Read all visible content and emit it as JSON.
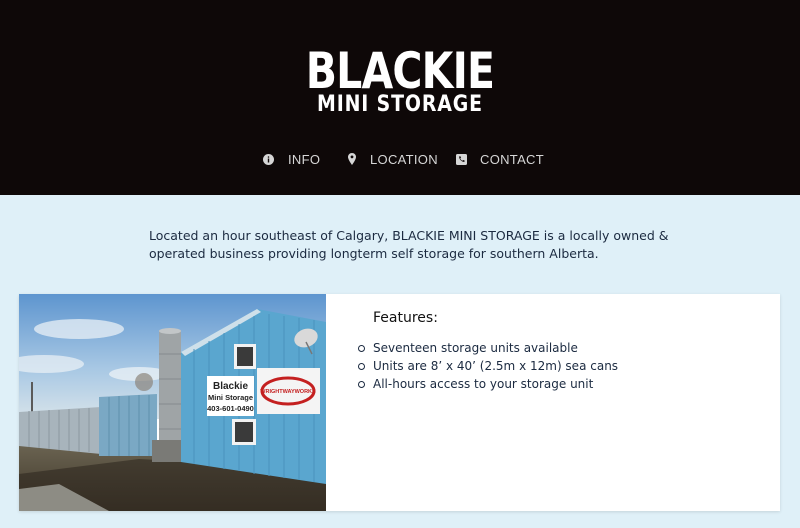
{
  "brand": {
    "name_line1": "BLACKIE",
    "name_line2": "MINI STORAGE"
  },
  "nav": [
    {
      "label": "INFO",
      "icon": "info-icon"
    },
    {
      "label": "LOCATION",
      "icon": "map-pin-icon"
    },
    {
      "label": "CONTACT",
      "icon": "phone-icon"
    }
  ],
  "intro": {
    "text": "Located an hour southeast of Calgary, BLACKIE MINI STORAGE is a locally owned & operated business providing longterm self storage for southern Alberta."
  },
  "features": {
    "title": "Features:",
    "items": [
      "Seventeen storage units available",
      "Units are 8’ x 40’ (2.5m x 12m) sea cans",
      "All-hours access to your storage unit"
    ]
  },
  "photo": {
    "sign_line1": "Blackie",
    "sign_line2": "Mini Storage",
    "sign_phone": "403-601-0490",
    "banner_text": "WRIGHTWAYWORKS"
  },
  "colors": {
    "header_bg": "#0e0808",
    "page_bg": "#dff0f8",
    "text": "#1b2a40",
    "building_blue": "#5aa6cf"
  }
}
